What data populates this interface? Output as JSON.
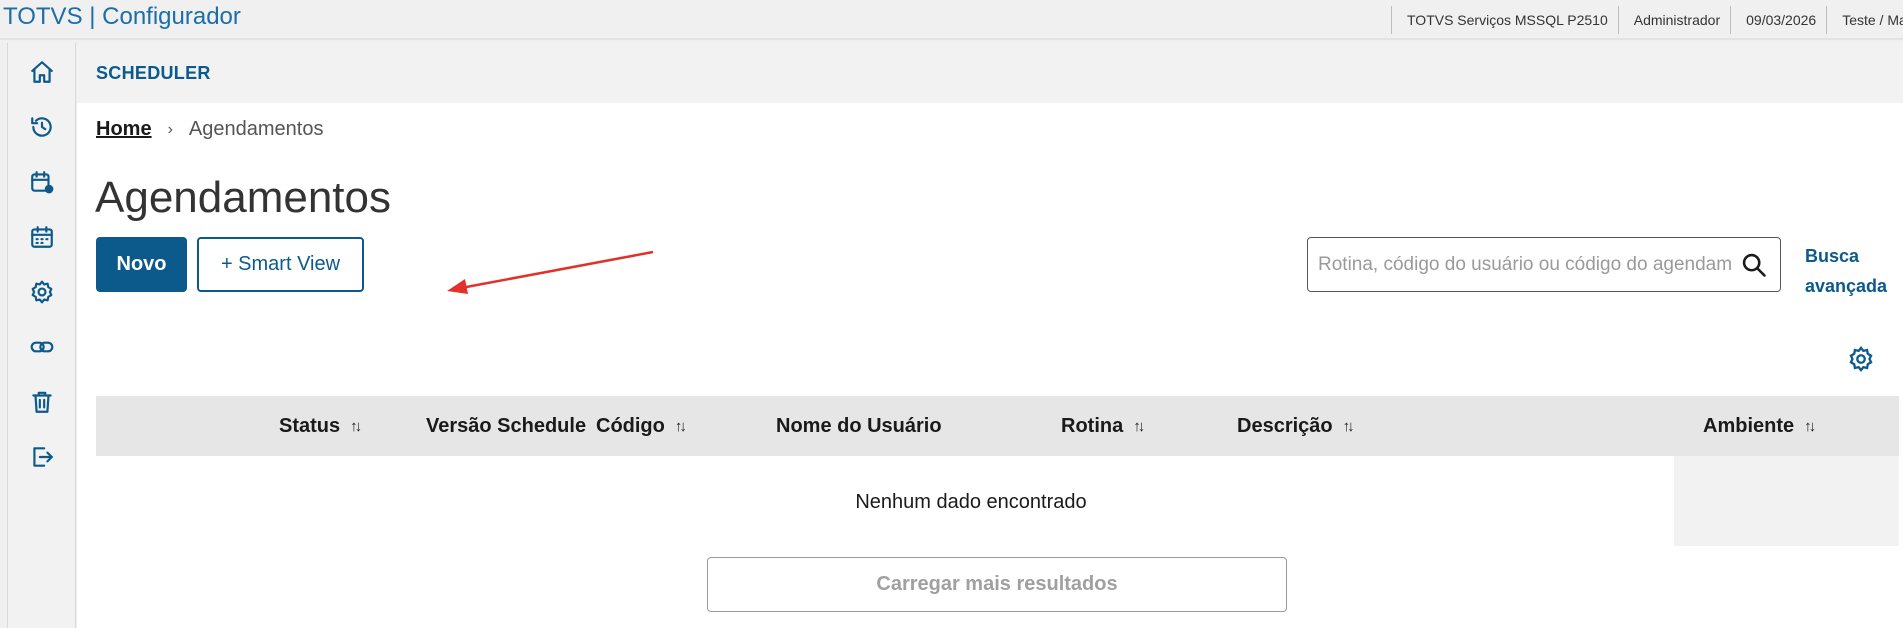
{
  "app": {
    "title": "TOTVS | Configurador",
    "company": "TOTVS Serviços MSSQL P2510",
    "user": "Administrador",
    "date": "09/03/2026",
    "branch": "Teste / Matriz"
  },
  "sidebar": {
    "items": [
      {
        "icon": "home-icon"
      },
      {
        "icon": "history-icon"
      },
      {
        "icon": "calendar-settings-icon"
      },
      {
        "icon": "calendar-icon"
      },
      {
        "icon": "gear-icon"
      },
      {
        "icon": "link-icon"
      },
      {
        "icon": "trash-icon"
      },
      {
        "icon": "logout-icon"
      }
    ]
  },
  "header": {
    "label": "SCHEDULER"
  },
  "breadcrumb": {
    "home": "Home",
    "separator": "›",
    "current": "Agendamentos"
  },
  "page": {
    "title": "Agendamentos",
    "new_button": "Novo",
    "smart_view_button": "+ Smart View"
  },
  "search": {
    "placeholder": "Rotina, código do usuário ou código do agendamento",
    "value": "",
    "advanced_label": "Busca avançada"
  },
  "table": {
    "columns": [
      {
        "label": "Status",
        "sortable": true
      },
      {
        "label": "Versão Schedule",
        "sortable": false
      },
      {
        "label": "Código",
        "sortable": true
      },
      {
        "label": "Nome do Usuário",
        "sortable": false
      },
      {
        "label": "Rotina",
        "sortable": true
      },
      {
        "label": "Descrição",
        "sortable": true
      },
      {
        "label": "Ambiente",
        "sortable": true
      }
    ],
    "sort_glyph": "↑↓",
    "empty_message": "Nenhum dado encontrado",
    "load_more_label": "Carregar mais resultados"
  },
  "colors": {
    "primary": "#0c5a8c",
    "annotation_arrow": "#e0322b",
    "header_bg": "#e6e6e6"
  }
}
